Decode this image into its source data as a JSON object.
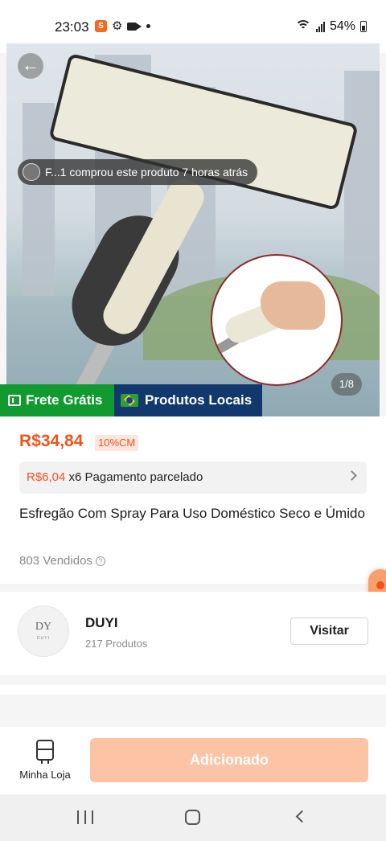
{
  "status_bar": {
    "time": "23:03",
    "app_icon_letter": "S",
    "battery": "54%",
    "icons": [
      "app-icon",
      "gear-icon",
      "video-camera-icon",
      "dot-icon",
      "wifi-icon",
      "signal-icon",
      "battery-icon"
    ]
  },
  "hero": {
    "toast_text": "F...1 comprou este produto 7 horas atrás",
    "image_counter": "1/8"
  },
  "badges": {
    "frete": "Frete Grátis",
    "locais": "Produtos Locais"
  },
  "product": {
    "price": "R$34,84",
    "discount": "10%CM",
    "installment_amount": "R$6,04",
    "installment_text": " x6 Pagamento parcelado",
    "title": "Esfregão Com Spray Para Uso Doméstico Seco e Úmido",
    "sold": "803 Vendidos"
  },
  "shop": {
    "logo_mono": "DY",
    "logo_sub": "DUYI",
    "name": "DUYI",
    "products": "217 Produtos",
    "visit_label": "Visitar"
  },
  "action_bar": {
    "store_label": "Minha Loja",
    "add_label": "Adicionado"
  },
  "colors": {
    "accent": "#f0531b",
    "frete_green": "#119a2f",
    "locais_blue": "#11396d",
    "add_button": "#fcc3a5"
  }
}
